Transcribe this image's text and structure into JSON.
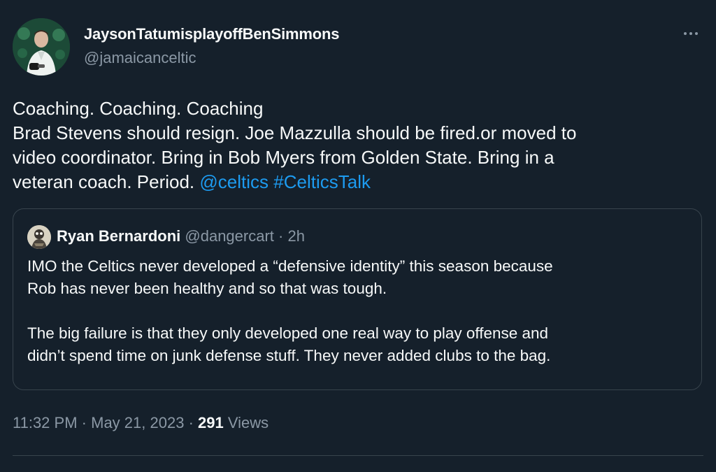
{
  "author": {
    "name": "JaysonTatumisplayoffBenSimmons",
    "handle": "@jamaicanceltic",
    "avatar_icon": "avatar-photo"
  },
  "tweet": {
    "lines": [
      "Coaching. Coaching. Coaching",
      "Brad Stevens should resign. Joe Mazzulla should be fired.or moved to",
      "video coordinator. Bring in Bob Myers from Golden State. Bring in a",
      "veteran coach. Period."
    ],
    "mention": "@celtics",
    "hashtag": "#CelticsTalk"
  },
  "quote": {
    "name": "Ryan Bernardoni",
    "handle": "@dangercart",
    "time": "2h",
    "separator": "·",
    "paragraph1": [
      "IMO the Celtics never developed a “defensive identity” this season because",
      "Rob has never been healthy and so that was tough."
    ],
    "paragraph2": [
      "The big failure is that they only developed one real way to play offense and",
      "didn’t spend time on junk defense stuff. They never added clubs to the bag."
    ]
  },
  "footer": {
    "time": "11:32 PM",
    "separator": "·",
    "date": "May 21, 2023",
    "views_count": "291",
    "views_label": "Views"
  },
  "colors": {
    "background": "#15202b",
    "link": "#1d9bf0",
    "secondary_text": "#8b98a5",
    "border": "#38444d"
  }
}
